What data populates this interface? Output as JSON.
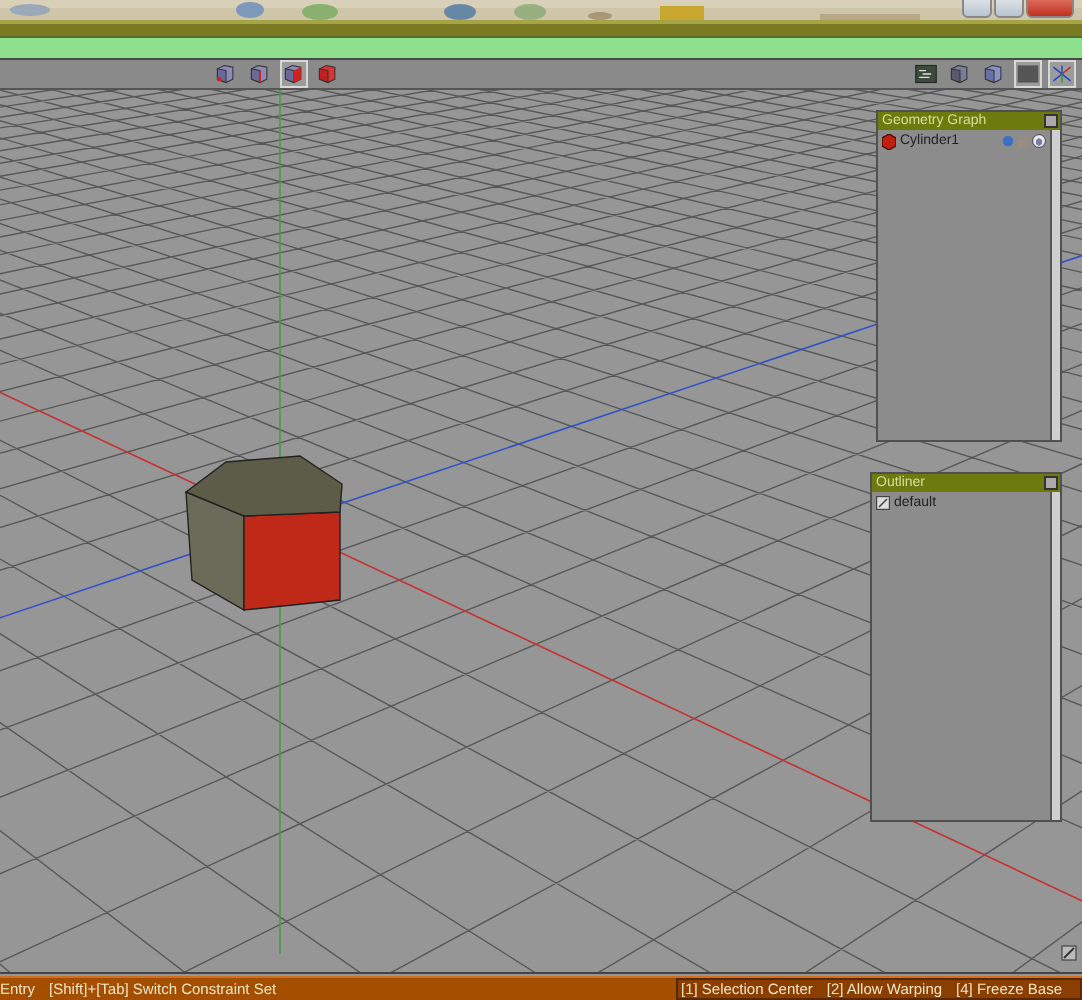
{
  "toolbar": {
    "left_buttons": [
      {
        "kind": "vertex",
        "selected": false
      },
      {
        "kind": "edge",
        "selected": false
      },
      {
        "kind": "face",
        "selected": true
      },
      {
        "kind": "object",
        "selected": false
      }
    ],
    "right_buttons": [
      {
        "kind": "graph",
        "selected": false
      },
      {
        "kind": "shaded",
        "selected": false
      },
      {
        "kind": "box",
        "selected": false
      },
      {
        "kind": "texture",
        "selected": true
      },
      {
        "kind": "axes",
        "selected": true
      }
    ]
  },
  "geometry_graph": {
    "title": "Geometry Graph",
    "items": [
      {
        "name": "Cylinder1",
        "visible": true,
        "locked": false
      }
    ]
  },
  "outliner": {
    "title": "Outliner",
    "items": [
      {
        "name": "default"
      }
    ]
  },
  "status_bar": {
    "left": [
      "Entry",
      "[Shift]+[Tab] Switch Constraint Set"
    ],
    "right": [
      "[1] Selection Center",
      "[2] Allow Warping",
      "[4] Freeze Base"
    ]
  }
}
